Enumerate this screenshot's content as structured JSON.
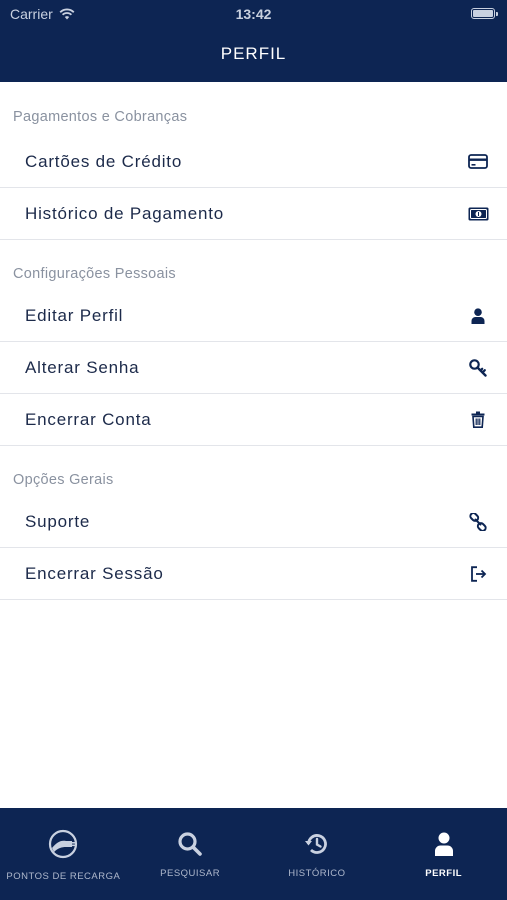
{
  "status_bar": {
    "carrier": "Carrier",
    "time": "13:42"
  },
  "header": {
    "title": "PERFIL"
  },
  "sections": [
    {
      "title": "Pagamentos e Cobranças",
      "items": [
        {
          "label": "Cartões de Crédito",
          "icon": "credit-card-icon"
        },
        {
          "label": "Histórico de Pagamento",
          "icon": "money-bill-icon"
        }
      ]
    },
    {
      "title": "Configurações Pessoais",
      "items": [
        {
          "label": "Editar Perfil",
          "icon": "user-icon"
        },
        {
          "label": "Alterar Senha",
          "icon": "key-icon"
        },
        {
          "label": "Encerrar Conta",
          "icon": "trash-icon"
        }
      ]
    },
    {
      "title": "Opções Gerais",
      "items": [
        {
          "label": "Suporte",
          "icon": "link-icon"
        },
        {
          "label": "Encerrar Sessão",
          "icon": "sign-out-icon"
        }
      ]
    }
  ],
  "tabbar": {
    "tabs": [
      {
        "label": "PONTOS DE RECARGA",
        "icon": "charging-plug-icon",
        "active": false
      },
      {
        "label": "PESQUISAR",
        "icon": "search-icon",
        "active": false
      },
      {
        "label": "HISTÓRICO",
        "icon": "history-icon",
        "active": false
      },
      {
        "label": "PERFIL",
        "icon": "user-icon",
        "active": true
      }
    ]
  },
  "colors": {
    "primary": "#0d2553",
    "text": "#1c2a4a",
    "section_title": "#8a92a0",
    "divider": "#e3e5ea",
    "tab_inactive": "#aeb8cc"
  }
}
